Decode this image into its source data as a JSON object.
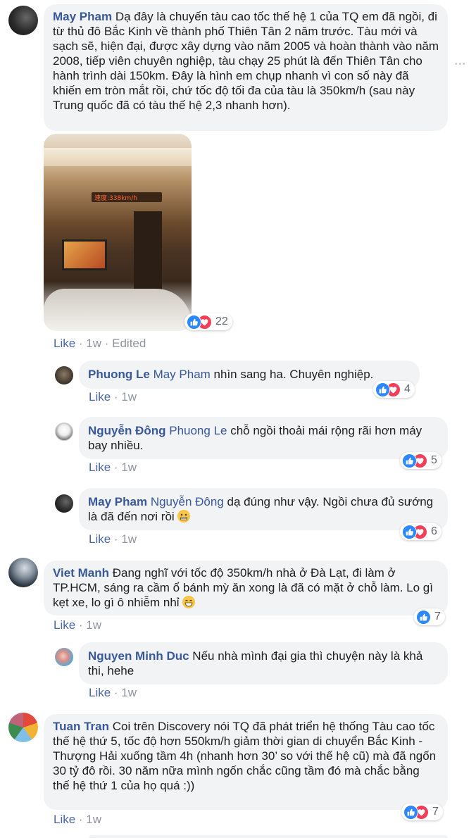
{
  "comments": [
    {
      "author": "May Pham",
      "text": "Dạ đây là chuyến tàu cao tốc thế hệ 1 của TQ em đã ngồi, đi từ thủ đô Bắc Kinh về thành phố Thiên Tân 2 năm trước. Tàu mới và sạch sẽ, hiện đại, được xây dựng vào năm 2005 và hoàn thành vào năm 2008, tiếp viên chuyên nghiệp, tàu chạy 25 phút là đến Thiên Tân cho hành trình dài 150km. Đây là hình em chụp nhanh vì con số này đã khiến em tròn mắt rồi, chứ tốc độ tối đa của tàu là 350km/h (sau này Trung quốc đã có tàu thế hệ 2,3 nhanh hơn).",
      "photo_caption": "速度:338km/h",
      "reactions": "22",
      "like": "Like",
      "time": "1w",
      "edited": "Edited",
      "replies": [
        {
          "author": "Phuong Le",
          "tag": "May Pham",
          "text": "nhìn sang ha. Chuyên nghiệp.",
          "reactions": "4",
          "like": "Like",
          "time": "1w"
        },
        {
          "author": "Nguyễn Đông",
          "tag": "Phuong Le",
          "text": "chỗ ngồi thoải mái rộng rãi hơn máy bay nhiều.",
          "reactions": "5",
          "like": "Like",
          "time": "1w"
        },
        {
          "author": "May Pham",
          "tag": "Nguyễn Đông",
          "text": "dạ đúng như vậy. Ngồi chưa đủ sướng là đã đến nơi rồi",
          "reactions": "6",
          "like": "Like",
          "time": "1w"
        }
      ]
    },
    {
      "author": "Viet Manh",
      "text": "Đang nghĩ với tốc độ 350km/h nhà ở Đà Lạt, đi làm ở TP.HCM, sáng ra cầm ổ bánh mỳ ăn xong là đã có mặt ở chỗ làm. Lo gì kẹt xe, lo gì ô nhiễm nhỉ",
      "reactions": "7",
      "like": "Like",
      "time": "1w",
      "replies": [
        {
          "author": "Nguyen Minh Duc",
          "tag": "",
          "text": "Nếu nhà mình đại gia thì chuyện này là khả thi, hehe",
          "like": "Like",
          "time": "1w"
        }
      ]
    },
    {
      "author": "Tuan Tran",
      "text": "Coi trên Discovery nói TQ đã phát triển hệ thống Tàu cao tốc thế hệ thứ 5, tốc độ hơn 550km/h giảm thời gian di chuyển Bắc Kinh - Thượng Hải xuống tầm 4h (nhanh hơn 30’ so với thế hệ cũ) mà đã ngốn 30 tỷ đô rồi. 30 năm nữa mình ngốn chắc cũng tầm đó mà chắc bằng thế hệ thứ 1 của họ quá :))",
      "reactions": "7",
      "like": "Like",
      "time": "1w"
    }
  ],
  "ui": {
    "more_glyph": "•••",
    "separator": " · "
  },
  "colors": {
    "link": "#385898",
    "bubble": "#f2f3f5",
    "like_blue": "#2d88ff",
    "love_red": "#f33e58"
  }
}
